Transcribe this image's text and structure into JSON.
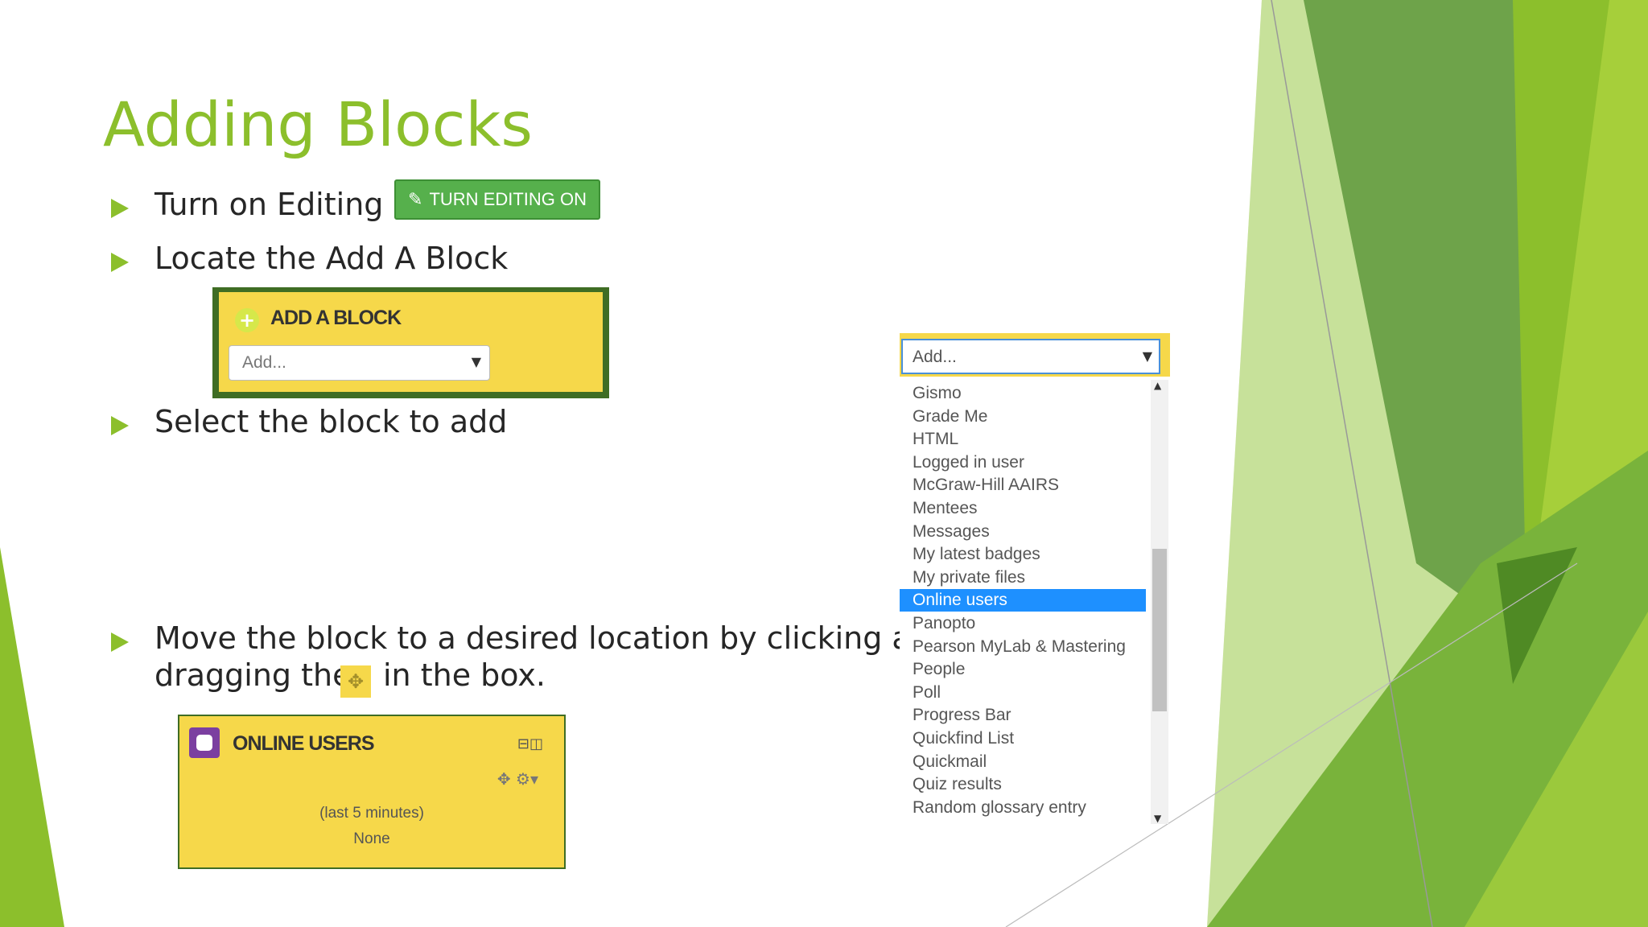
{
  "slide": {
    "title": "Adding Blocks",
    "bullets": [
      "Turn on Editing",
      "Locate the Add A Block",
      "Select the block to add",
      "Move the block to a desired location by clicking and",
      "dragging the",
      "in the box."
    ],
    "accent_color": "#8cbf2c"
  },
  "turn_editing_button": {
    "label": "TURN EDITING ON",
    "icon": "edit-icon"
  },
  "add_block_panel": {
    "header": "ADD A BLOCK",
    "icon": "plus-circle-icon",
    "select_value": "Add..."
  },
  "block_list": {
    "select_value": "Add...",
    "items": [
      "Gismo",
      "Grade Me",
      "HTML",
      "Logged in user",
      "McGraw-Hill AAIRS",
      "Mentees",
      "Messages",
      "My latest badges",
      "My private files",
      "Online users",
      "Panopto",
      "Pearson MyLab & Mastering",
      "People",
      "Poll",
      "Progress Bar",
      "Quickfind List",
      "Quickmail",
      "Quiz results",
      "Random glossary entry"
    ],
    "selected": "Online users"
  },
  "online_users_block": {
    "header": "ONLINE USERS",
    "subtitle": "(last 5 minutes)",
    "value": "None",
    "icon": "users-icon"
  }
}
